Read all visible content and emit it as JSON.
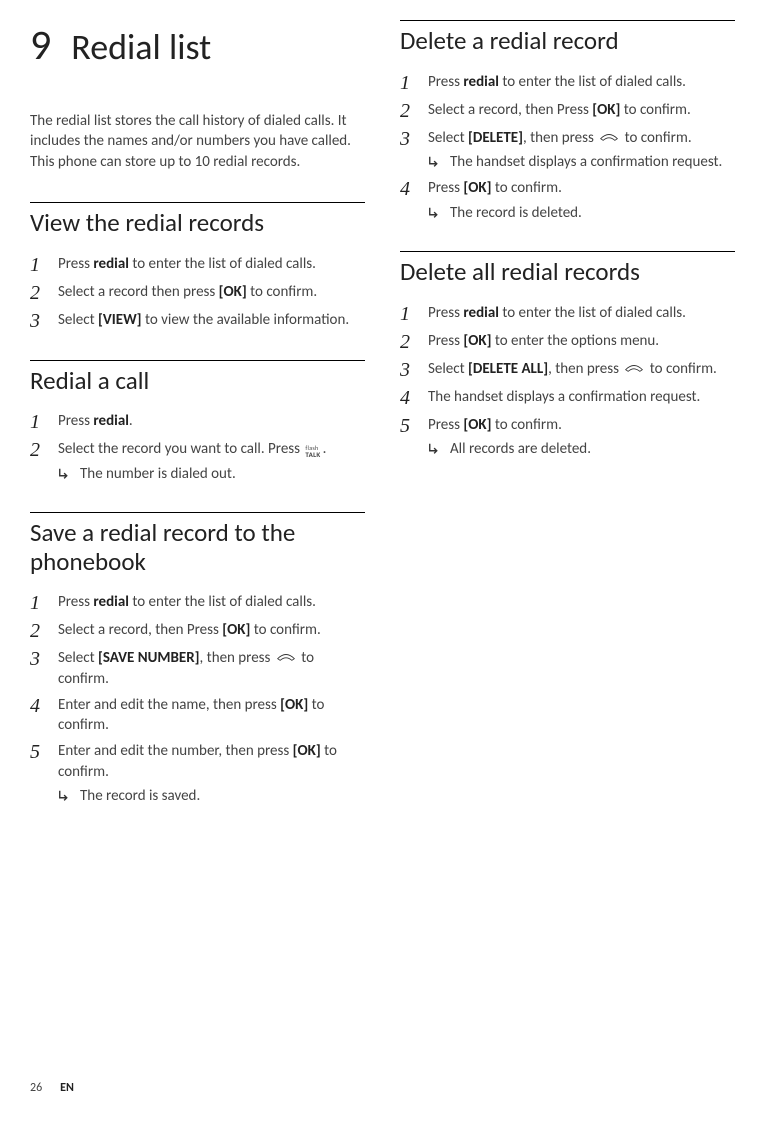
{
  "chapter": {
    "number": "9",
    "title": "Redial list"
  },
  "intro": "The redial list stores the call history of dialed calls. It includes the names and/or numbers you have called. This phone can store up to 10 redial records.",
  "left": {
    "s1": {
      "title": "View the redial records",
      "st1a": "Press ",
      "st1b": "redial",
      "st1c": " to enter the list of dialed calls.",
      "st2a": "Select a record then press ",
      "st2b": "[OK]",
      "st2c": " to confirm.",
      "st3a": "Select ",
      "st3b": "[VIEW]",
      "st3c": " to view the available information."
    },
    "s2": {
      "title": "Redial a call",
      "st1a": "Press ",
      "st1b": "redial",
      "st1c": ".",
      "st2a": "Select the record you want to call. Press ",
      "st2b": ".",
      "r1": "The number is dialed out."
    },
    "s3": {
      "title": "Save a redial record to the phonebook",
      "st1a": "Press ",
      "st1b": "redial",
      "st1c": " to enter the list of dialed calls.",
      "st2a": "Select a record, then Press ",
      "st2b": "[OK]",
      "st2c": " to confirm.",
      "st3a": "Select ",
      "st3b": "[SAVE NUMBER]",
      "st3c": ", then press ",
      "st3d": " to confirm.",
      "st4a": "Enter and edit the name, then press ",
      "st4b": "[OK]",
      "st4c": " to confirm.",
      "st5a": "Enter and edit the number, then press ",
      "st5b": "[OK]",
      "st5c": " to confirm.",
      "r1": "The record is saved."
    }
  },
  "right": {
    "s1": {
      "title": "Delete a redial record",
      "st1a": "Press ",
      "st1b": "redial",
      "st1c": " to enter the list of dialed calls.",
      "st2a": "Select a record, then Press ",
      "st2b": "[OK]",
      "st2c": " to confirm.",
      "st3a": "Select ",
      "st3b": "[DELETE]",
      "st3c": ", then press ",
      "st3d": " to confirm.",
      "r3": "The handset displays a confirmation request.",
      "st4a": "Press ",
      "st4b": "[OK]",
      "st4c": " to confirm.",
      "r4": "The record is deleted."
    },
    "s2": {
      "title": "Delete all redial records",
      "st1a": "Press ",
      "st1b": "redial",
      "st1c": " to enter the list of dialed calls.",
      "st2a": "Press ",
      "st2b": "[OK]",
      "st2c": " to enter the options menu.",
      "st3a": "Select ",
      "st3b": "[DELETE ALL]",
      "st3c": ", then press ",
      "st3d": " to confirm.",
      "st4": "The handset displays a confirmation request.",
      "st5a": "Press ",
      "st5b": "[OK]",
      "st5c": " to confirm.",
      "r5": "All records are deleted."
    }
  },
  "footer": {
    "page": "26",
    "lang": "EN"
  }
}
